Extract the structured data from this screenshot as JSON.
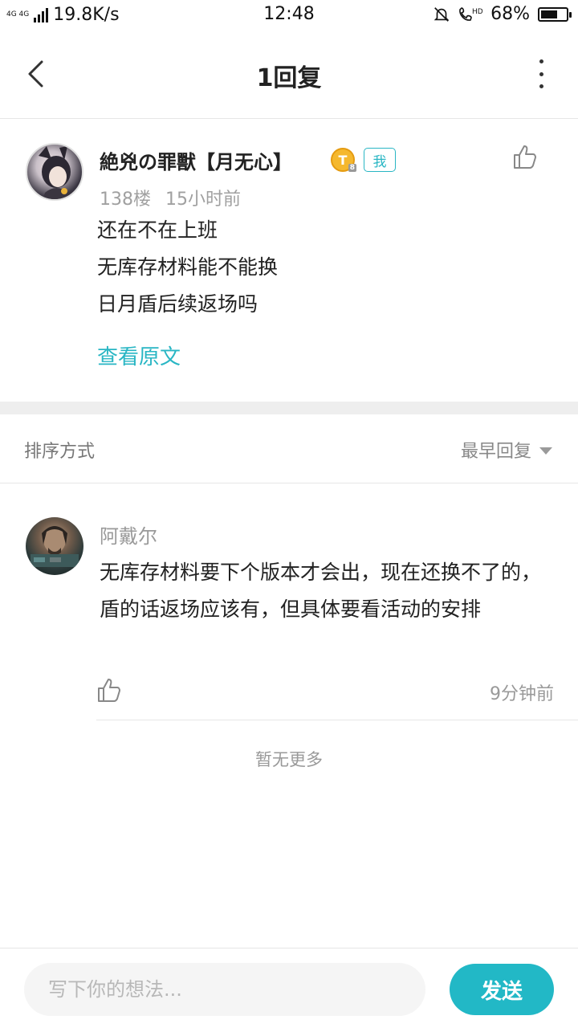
{
  "status_bar": {
    "network": "4G 4G",
    "speed": "19.8K/s",
    "time": "12:48",
    "hd": "HD",
    "battery": "68%",
    "battery_level": 0.68
  },
  "header": {
    "title": "1回复",
    "back_icon": "chevron-left-icon",
    "more_icon": "more-vertical-icon"
  },
  "post": {
    "author": "絶兇の罪獸【月无心】",
    "level_badge": "T",
    "level_num": "8",
    "me_badge": "我",
    "floor": "138楼",
    "time": "15小时前",
    "lines": [
      "还在不在上班",
      "无库存材料能不能换",
      "日月盾后续返场吗"
    ],
    "view_original": "查看原文"
  },
  "sort": {
    "label": "排序方式",
    "selected": "最早回复"
  },
  "reply": {
    "author": "阿戴尔",
    "text": "无库存材料要下个版本才会出，现在还换不了的，盾的话返场应该有，但具体要看活动的安排",
    "time": "9分钟前"
  },
  "no_more": "暂无更多",
  "composer": {
    "placeholder": "写下你的想法...",
    "send_label": "发送"
  },
  "colors": {
    "accent": "#22b8c6",
    "gold_badge": "#f5b82e"
  }
}
